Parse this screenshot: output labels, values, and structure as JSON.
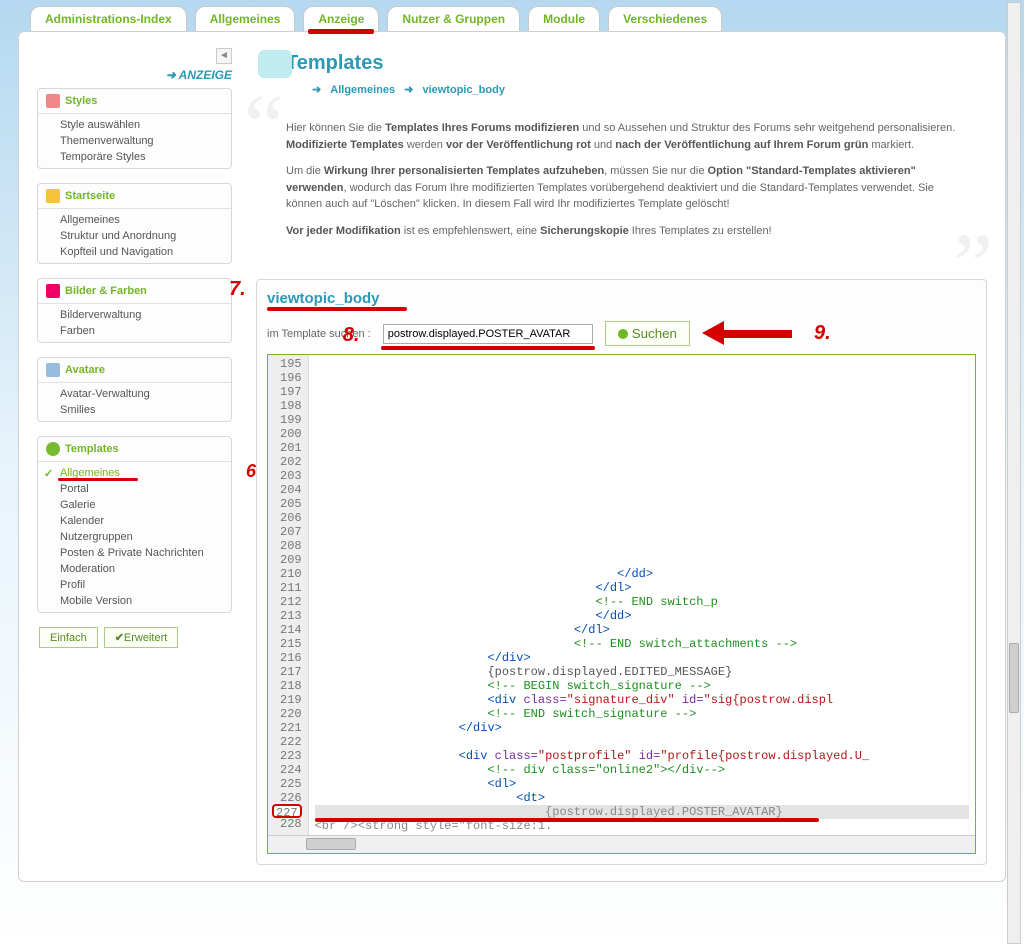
{
  "tabs": {
    "items": [
      {
        "label": "Administrations-Index"
      },
      {
        "label": "Allgemeines"
      },
      {
        "label": "Anzeige",
        "active": true
      },
      {
        "label": "Nutzer & Gruppen"
      },
      {
        "label": "Module"
      },
      {
        "label": "Verschiedenes"
      }
    ]
  },
  "sidebar": {
    "crumb": "ANZEIGE",
    "groups": [
      {
        "title": "Styles",
        "icon": "palette-icon",
        "items": [
          "Style auswählen",
          "Themenverwaltung",
          "Temporäre Styles"
        ]
      },
      {
        "title": "Startseite",
        "icon": "world-icon",
        "items": [
          "Allgemeines",
          "Struktur und Anordnung",
          "Kopfteil und Navigation"
        ]
      },
      {
        "title": "Bilder & Farben",
        "icon": "image-icon",
        "items": [
          "Bilderverwaltung",
          "Farben"
        ]
      },
      {
        "title": "Avatare",
        "icon": "avatar-icon",
        "items": [
          "Avatar-Verwaltung",
          "Smilies"
        ]
      },
      {
        "title": "Templates",
        "icon": "plus-icon",
        "items": [
          "Allgemeines",
          "Portal",
          "Galerie",
          "Kalender",
          "Nutzergruppen",
          "Posten & Private Nachrichten",
          "Moderation",
          "Profil",
          "Mobile Version"
        ],
        "selected": 0
      }
    ],
    "btn_simple": "Einfach",
    "btn_advanced": "Erweitert"
  },
  "content": {
    "title": "Templates",
    "breadcrumb": {
      "a": "Allgemeines",
      "b": "viewtopic_body"
    },
    "intro": {
      "p1a": "Hier können Sie die ",
      "p1b": "Templates Ihres Forums modifizieren",
      "p1c": " und so Aussehen und Struktur des Forums sehr weitgehend personalisieren. ",
      "p1d": "Modifizierte Templates",
      "p1e": " werden ",
      "p1f": "vor der Veröffentlichung rot",
      "p1g": " und ",
      "p1h": "nach der Veröffentlichung auf Ihrem Forum grün",
      "p1i": " markiert.",
      "p2a": "Um die ",
      "p2b": "Wirkung Ihrer personalisierten Templates aufzuheben",
      "p2c": ", müssen Sie nur die ",
      "p2d": "Option \"Standard-Templates aktivieren\" verwenden",
      "p2e": ", wodurch das Forum Ihre modifizierten Templates vorübergehend deaktiviert und die Standard-Templates verwendet. Sie können auch auf \"Löschen\" klicken. In diesem Fall wird Ihr modifiziertes Template gelöscht!",
      "p3a": "Vor jeder Modifikation",
      "p3b": " ist es empfehlenswert, eine ",
      "p3c": "Sicherungskopie",
      "p3d": " Ihres Templates zu erstellen!"
    },
    "editor": {
      "title": "viewtopic_body",
      "search_label": "im Template suchen :",
      "search_value": "postrow.displayed.POSTER_AVATAR",
      "search_btn": "Suchen",
      "line_start": 195,
      "line_end": 228,
      "highlight_line": 227,
      "code_lines": [
        "",
        "",
        "",
        "",
        "",
        "",
        "",
        "",
        "",
        "",
        "",
        "",
        "",
        "",
        "",
        {
          "txt": "                                          </dd>",
          "cls": "tblue"
        },
        {
          "txt": "                                       </dl>",
          "cls": "tblue"
        },
        {
          "txt": "                                       <!-- END switch_p",
          "cls": "tgreen"
        },
        {
          "txt": "                                       </dd>",
          "cls": "tblue"
        },
        {
          "txt": "                                    </dl>",
          "cls": "tblue"
        },
        {
          "txt": "                                    <!-- END switch_attachments -->",
          "cls": "tgreen"
        },
        {
          "txt": "                        </div>",
          "cls": "tblue"
        },
        {
          "segments": [
            {
              "t": "                        ",
              "c": ""
            },
            {
              "t": "{postrow.displayed.EDITED_MESSAGE}",
              "c": ""
            }
          ]
        },
        {
          "txt": "                        <!-- BEGIN switch_signature -->",
          "cls": "tgreen"
        },
        {
          "segments": [
            {
              "t": "                        ",
              "c": ""
            },
            {
              "t": "<div ",
              "c": "tblue"
            },
            {
              "t": "class=",
              "c": "tpurple"
            },
            {
              "t": "\"signature_div\"",
              "c": "tred"
            },
            {
              "t": " id=",
              "c": "tpurple"
            },
            {
              "t": "\"sig{postrow.displ",
              "c": "tred"
            }
          ]
        },
        {
          "txt": "                        <!-- END switch_signature -->",
          "cls": "tgreen"
        },
        {
          "txt": "                    </div>",
          "cls": "tblue"
        },
        "",
        {
          "segments": [
            {
              "t": "                    ",
              "c": ""
            },
            {
              "t": "<div ",
              "c": "tblue"
            },
            {
              "t": "class=",
              "c": "tpurple"
            },
            {
              "t": "\"postprofile\"",
              "c": "tred"
            },
            {
              "t": " id=",
              "c": "tpurple"
            },
            {
              "t": "\"profile{postrow.displayed.U_",
              "c": "tred"
            }
          ]
        },
        {
          "segments": [
            {
              "t": "                        ",
              "c": ""
            },
            {
              "t": "<!-- div class=\"online2\"></div-->",
              "c": "tgreen"
            }
          ]
        },
        {
          "txt": "                        <dl>",
          "cls": "tblue"
        },
        {
          "txt": "                            <dt>",
          "cls": "tblue"
        },
        {
          "txt": "                                {postrow.displayed.POSTER_AVATAR}",
          "cls": "tgray",
          "hl": true
        },
        {
          "segments": [
            {
              "t": "<br /><strong style=\"font-size:1.",
              "c": "tgray"
            }
          ]
        }
      ]
    }
  },
  "annotations": {
    "a6": "6.",
    "a7": "7.",
    "a8": "8.",
    "a9": "9."
  }
}
